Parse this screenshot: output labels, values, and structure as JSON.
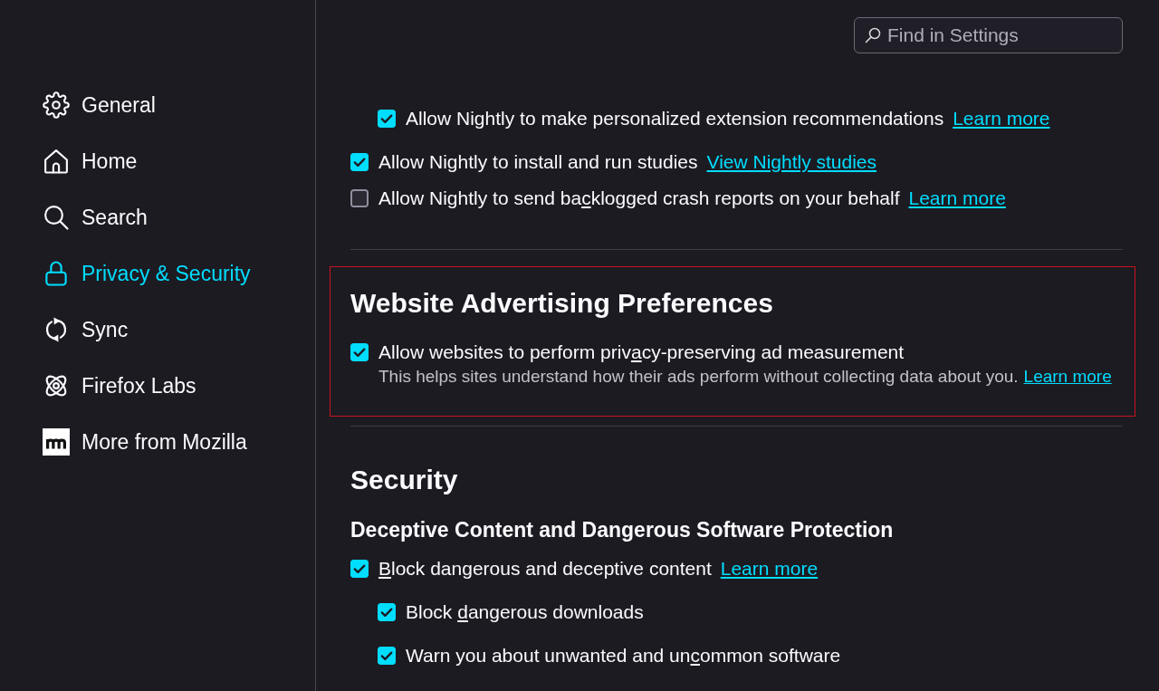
{
  "search": {
    "placeholder": "Find in Settings"
  },
  "sidebar": {
    "items": [
      {
        "label": "General",
        "selected": false
      },
      {
        "label": "Home",
        "selected": false
      },
      {
        "label": "Search",
        "selected": false
      },
      {
        "label": "Privacy & Security",
        "selected": true
      },
      {
        "label": "Sync",
        "selected": false
      },
      {
        "label": "Firefox Labs",
        "selected": false
      },
      {
        "label": "More from Mozilla",
        "selected": false
      }
    ]
  },
  "sections": [
    {
      "continued_children": [
        {
          "label": "Allow Nightly to make personalized extension recommendations",
          "checked": true,
          "link": "Learn more"
        }
      ],
      "options": [
        {
          "label": "Allow Nightly to install and run studies",
          "checked": true,
          "link": "View Nightly studies"
        },
        {
          "label_parts": [
            {
              "text": "Allow Nightly to send ba",
              "underlined": false
            },
            {
              "text": "c",
              "underlined": true
            },
            {
              "text": "klogged crash reports on your behalf",
              "underlined": false
            }
          ],
          "checked": false,
          "link": "Learn more"
        }
      ]
    },
    {
      "title": "Website Advertising Preferences",
      "highlighted": true,
      "options": [
        {
          "label_parts": [
            {
              "text": "Allow websites to perform priv",
              "underlined": false
            },
            {
              "text": "a",
              "underlined": true
            },
            {
              "text": "cy-preserving ad measurement",
              "underlined": false
            }
          ],
          "checked": true,
          "description": "This helps sites understand how their ads perform without collecting data about you.",
          "link": "Learn more"
        }
      ]
    },
    {
      "title": "Security",
      "subsections": [
        {
          "title": "Deceptive Content and Dangerous Software Protection",
          "options": [
            {
              "label_parts": [
                {
                  "text": "B",
                  "underlined": true
                },
                {
                  "text": "lock dangerous and deceptive content",
                  "underlined": false
                }
              ],
              "checked": true,
              "link": "Learn more",
              "children": [
                {
                  "label_parts": [
                    {
                      "text": "Block ",
                      "underlined": false
                    },
                    {
                      "text": "d",
                      "underlined": true
                    },
                    {
                      "text": "angerous downloads",
                      "underlined": false
                    }
                  ],
                  "checked": true
                },
                {
                  "label_parts": [
                    {
                      "text": "Warn you about unwanted and un",
                      "underlined": false
                    },
                    {
                      "text": "c",
                      "underlined": true
                    },
                    {
                      "text": "ommon software",
                      "underlined": false
                    }
                  ],
                  "checked": true
                }
              ]
            }
          ]
        }
      ]
    }
  ]
}
